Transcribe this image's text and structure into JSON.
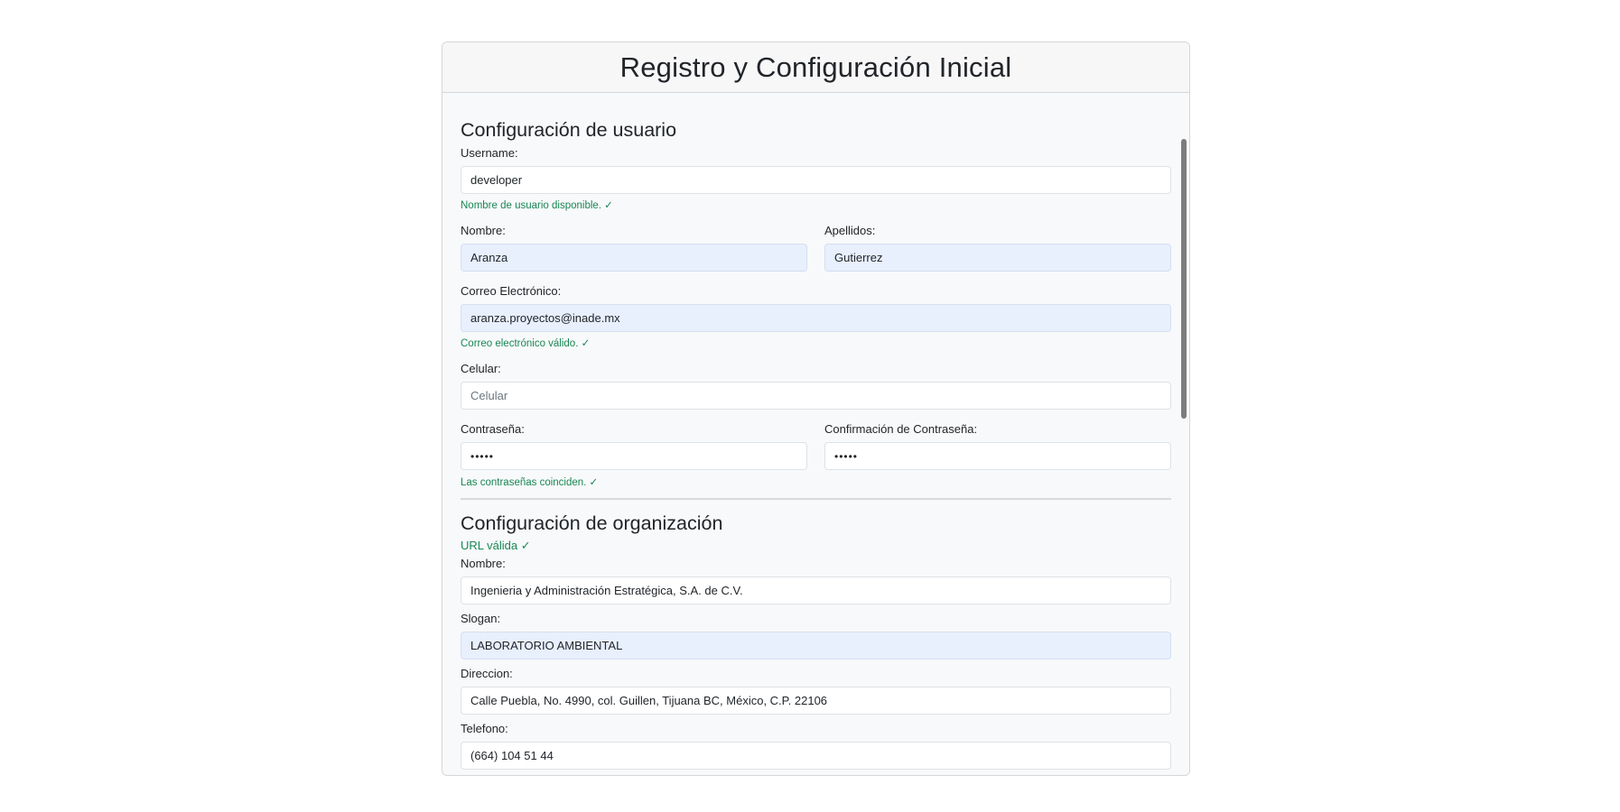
{
  "header": {
    "title": "Registro y Configuración Inicial"
  },
  "user_section": {
    "title": "Configuración de usuario",
    "username": {
      "label": "Username:",
      "value": "developer",
      "feedback": "Nombre de usuario disponible. ✓"
    },
    "first_name": {
      "label": "Nombre:",
      "value": "Aranza"
    },
    "last_name": {
      "label": "Apellidos:",
      "value": "Gutierrez"
    },
    "email": {
      "label": "Correo Electrónico:",
      "value": "aranza.proyectos@inade.mx",
      "feedback": "Correo electrónico válido. ✓"
    },
    "phone": {
      "label": "Celular:",
      "placeholder": "Celular"
    },
    "password": {
      "label": "Contraseña:",
      "value": "•••••"
    },
    "password_confirm": {
      "label": "Confirmación de Contraseña:",
      "value": "•••••"
    },
    "password_feedback": "Las contraseñas coinciden. ✓"
  },
  "org_section": {
    "title": "Configuración de organización",
    "url_feedback": "URL válida ✓",
    "name": {
      "label": "Nombre:",
      "value": "Ingenieria y Administración Estratégica, S.A. de C.V."
    },
    "slogan": {
      "label": "Slogan:",
      "value": "LABORATORIO AMBIENTAL"
    },
    "address": {
      "label": "Direccion:",
      "value": "Calle Puebla, No. 4990, col. Guillen, Tijuana BC, México, C.P. 22106"
    },
    "telephone": {
      "label": "Telefono:",
      "value": "(664) 104 51 44"
    }
  },
  "colors": {
    "success": "#198754",
    "autofill": "#e8f0fe",
    "card_bg": "#f8f9fa"
  }
}
